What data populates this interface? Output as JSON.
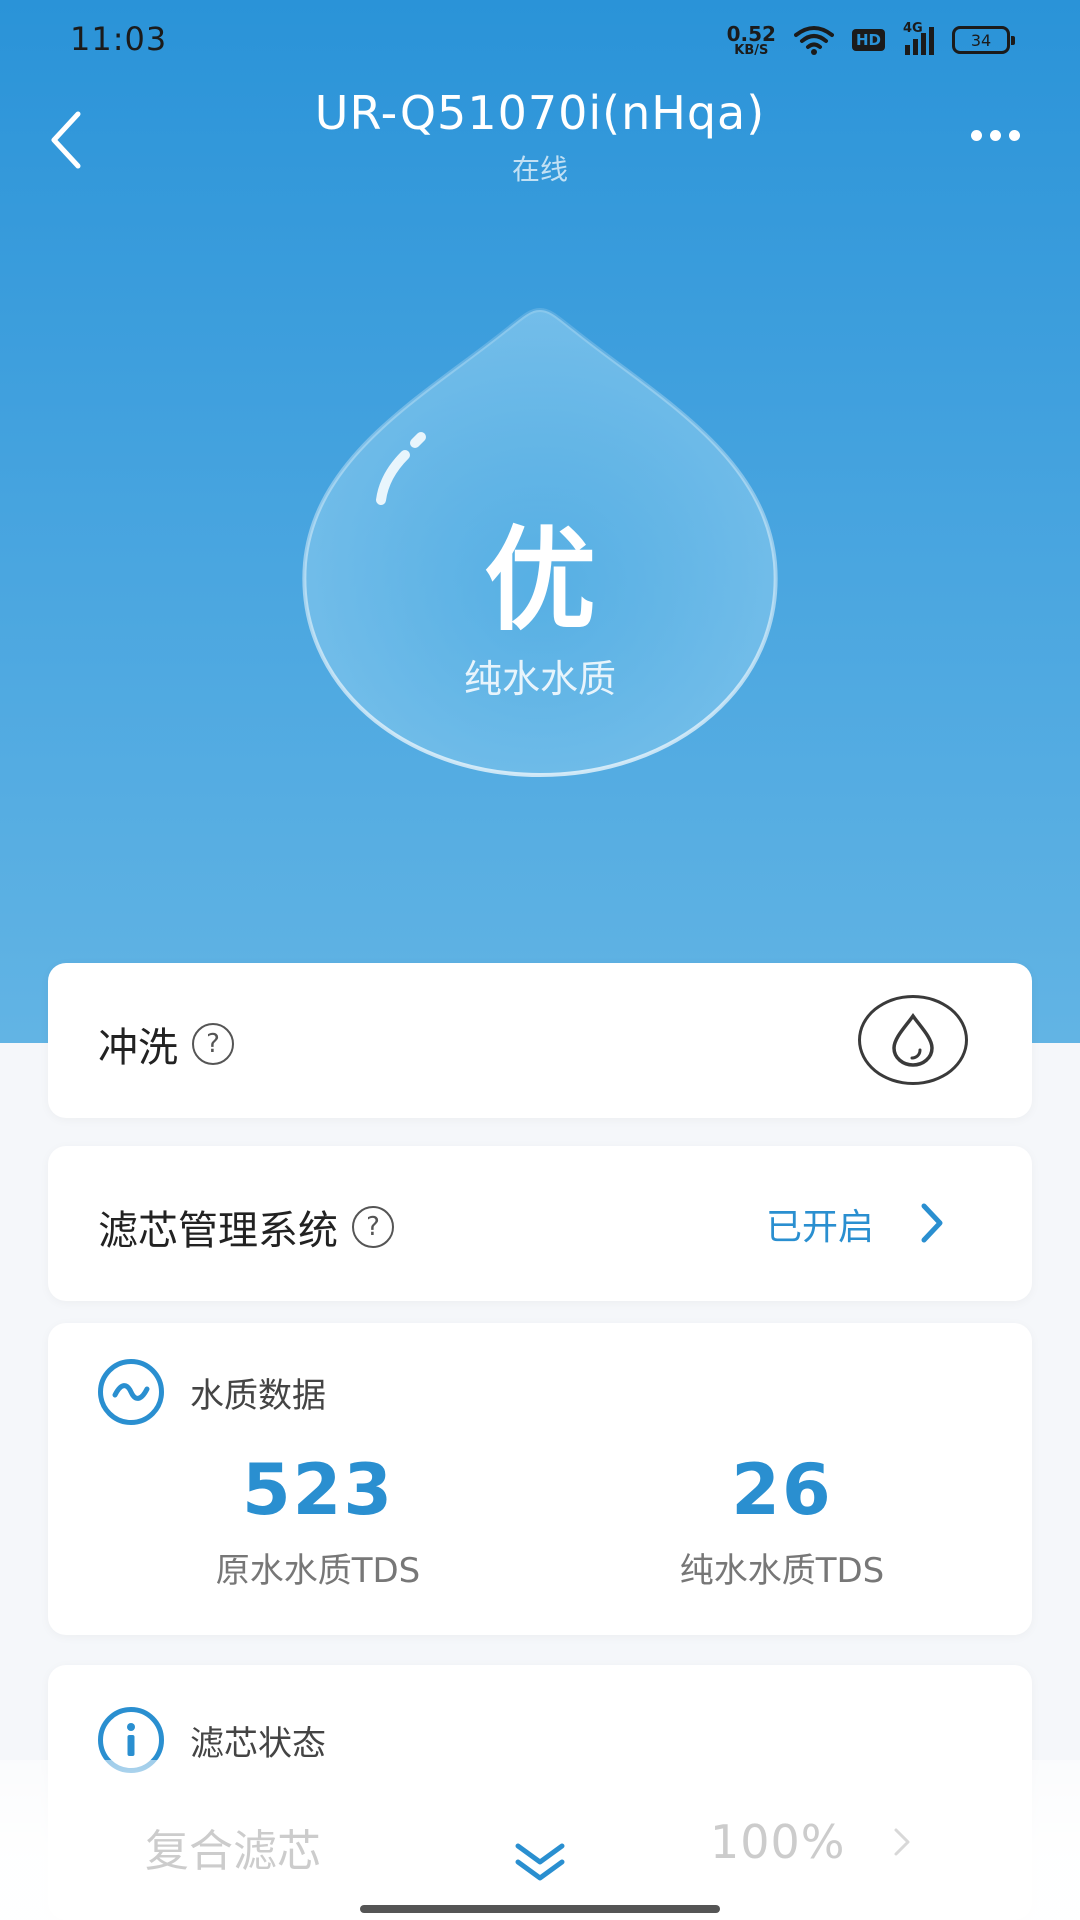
{
  "status_bar": {
    "time": "11:03",
    "net_speed_value": "0.52",
    "net_speed_unit": "KB/S",
    "hd": "HD",
    "network": "4G",
    "battery": "34",
    "icons": [
      "wifi-icon",
      "signal-icon",
      "battery-icon"
    ]
  },
  "nav": {
    "title": "UR-Q51070i(nHqa)",
    "subtitle": "在线",
    "icons": [
      "back-arrow-icon",
      "more-icon"
    ]
  },
  "hero": {
    "grade": "优",
    "label": "纯水水质",
    "icon": "water-drop-icon"
  },
  "flush": {
    "label": "冲洗",
    "help": "?",
    "icons": [
      "help-icon",
      "drop-icon"
    ]
  },
  "filter_system": {
    "label": "滤芯管理系统",
    "help": "?",
    "status": "已开启",
    "icons": [
      "help-icon",
      "chevron-right-icon"
    ]
  },
  "water_quality": {
    "title": "水质数据",
    "icon": "wave-icon",
    "metrics": [
      {
        "value": "523",
        "caption": "原水水质TDS"
      },
      {
        "value": "26",
        "caption": "纯水水质TDS"
      }
    ]
  },
  "filter_status": {
    "title": "滤芯状态",
    "icon": "info-icon",
    "items": [
      {
        "name": "复合滤芯",
        "percent": "100%"
      }
    ]
  },
  "colors": {
    "brand_blue": "#2a8fd0",
    "hero_top": "#2a93d8",
    "hero_bottom": "#62b4e4"
  }
}
